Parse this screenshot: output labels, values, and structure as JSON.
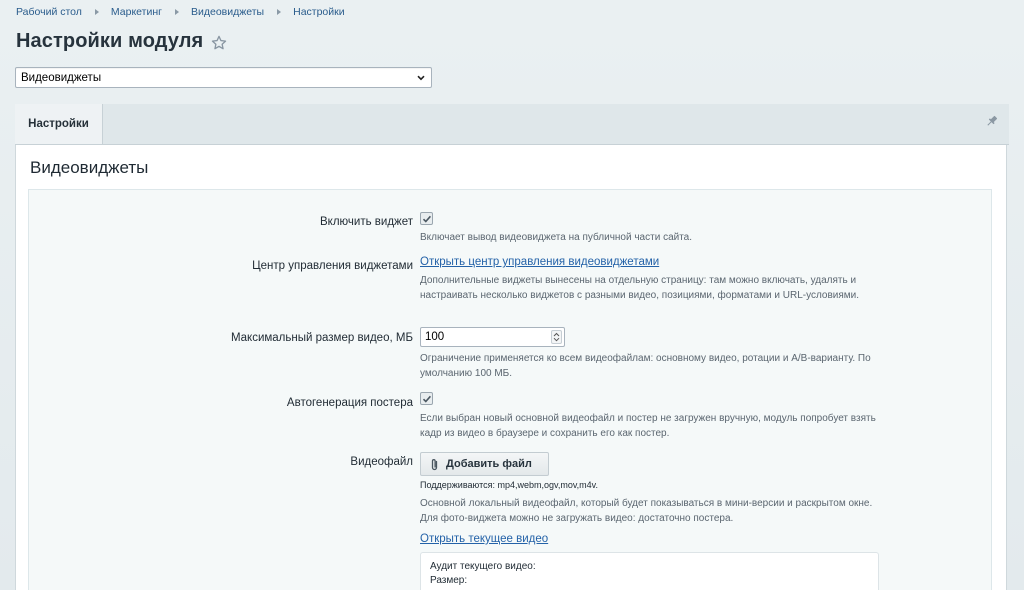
{
  "breadcrumbs": [
    {
      "label": "Рабочий стол"
    },
    {
      "label": "Маркетинг"
    },
    {
      "label": "Видеовиджеты"
    },
    {
      "label": "Настройки"
    }
  ],
  "page_title": "Настройки модуля",
  "module_select": {
    "selected": "Видеовиджеты"
  },
  "tabs": [
    {
      "label": "Настройки",
      "active": true
    }
  ],
  "section_title": "Видеовиджеты",
  "fields": {
    "enable_widget": {
      "label": "Включить виджет",
      "checked": true,
      "description": "Включает вывод видеовиджета на публичной части сайта."
    },
    "control_center": {
      "label": "Центр управления виджетами",
      "link": "Открыть центр управления видеовиджетами",
      "description": "Дополнительные виджеты вынесены на отдельную страницу: там можно включать, удалять и настраивать несколько виджетов с разными видео, позициями, форматами и URL-условиями."
    },
    "max_video_size": {
      "label": "Максимальный размер видео, МБ",
      "value": "100",
      "description": "Ограничение применяется ко всем видеофайлам: основному видео, ротации и A/B-варианту. По умолчанию 100 МБ."
    },
    "auto_poster": {
      "label": "Автогенерация постера",
      "checked": true,
      "description": "Если выбран новый основной видеофайл и постер не загружен вручную, модуль попробует взять кадр из видео в браузере и сохранить его как постер."
    },
    "video_file": {
      "label": "Видеофайл",
      "button": "Добавить файл",
      "supported": "Поддерживаются: mp4,webm,ogv,mov,m4v.",
      "description": "Основной локальный видеофайл, который будет показываться в мини-версии и раскрытом окне. Для фото-виджета можно не загружать видео: достаточно постера.",
      "link": "Открыть текущее видео",
      "audit_title": "Аудит текущего видео:",
      "audit_size": "Размер:"
    }
  },
  "colors": {
    "link": "#2462a8",
    "breadcrumb": "#2a5c8c",
    "background": "#e6edf0",
    "panel": "#ffffff",
    "inner_panel": "#f5f9f9"
  }
}
